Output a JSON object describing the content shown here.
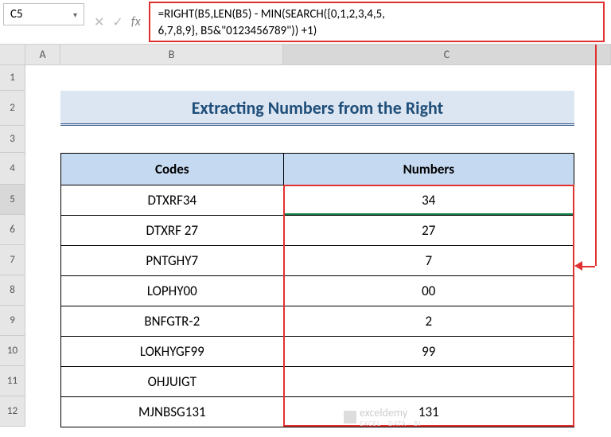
{
  "namebox": {
    "value": "C5"
  },
  "formula": {
    "line1": "=RIGHT(B5,LEN(B5) - MIN(SEARCH({0,1,2,3,4,5,",
    "line2": "6,7,8,9}, B5&\"0123456789\")) +1)"
  },
  "columns": {
    "A": "A",
    "B": "B",
    "C": "C"
  },
  "rows": [
    "1",
    "2",
    "3",
    "4",
    "5",
    "6",
    "7",
    "8",
    "9",
    "10",
    "11",
    "12"
  ],
  "title": "Extracting Numbers from the Right",
  "headers": {
    "codes": "Codes",
    "numbers": "Numbers"
  },
  "table": [
    {
      "code": "DTXRF34",
      "num": "34"
    },
    {
      "code": "DTXRF 27",
      "num": "27"
    },
    {
      "code": "PNTGHY7",
      "num": "7"
    },
    {
      "code": "LOPHY00",
      "num": "00"
    },
    {
      "code": "BNFGTR-2",
      "num": "2"
    },
    {
      "code": "LOKHYGF99",
      "num": "99"
    },
    {
      "code": "OHJUIGT",
      "num": ""
    },
    {
      "code": "MJNBSG131",
      "num": "131"
    }
  ],
  "watermark": {
    "brand": "exceldemy",
    "sub": "EXCEL · DATA · BI"
  },
  "chart_data": {
    "type": "table",
    "title": "Extracting Numbers from the Right",
    "columns": [
      "Codes",
      "Numbers"
    ],
    "rows": [
      [
        "DTXRF34",
        "34"
      ],
      [
        "DTXRF 27",
        "27"
      ],
      [
        "PNTGHY7",
        "7"
      ],
      [
        "LOPHY00",
        "00"
      ],
      [
        "BNFGTR-2",
        "2"
      ],
      [
        "LOKHYGF99",
        "99"
      ],
      [
        "OHJUIGT",
        ""
      ],
      [
        "MJNBSG131",
        "131"
      ]
    ]
  }
}
